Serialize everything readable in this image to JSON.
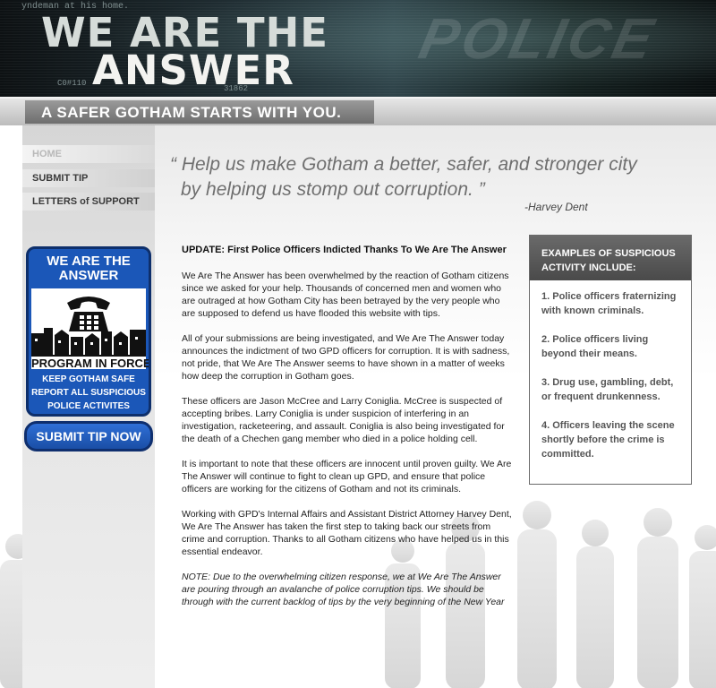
{
  "header": {
    "title_line1": "WE ARE THE",
    "title_line2": "ANSWER",
    "background_print": "yndeman at his home.",
    "code_a": "C0#110",
    "code_b": "31862",
    "tagline": "A SAFER GOTHAM STARTS WITH YOU."
  },
  "nav": {
    "items": [
      {
        "label": "HOME",
        "active": true
      },
      {
        "label": "SUBMIT TIP",
        "active": false
      },
      {
        "label": "LETTERS of SUPPORT",
        "active": false
      }
    ]
  },
  "badge": {
    "title_line1": "WE ARE THE",
    "title_line2": "ANSWER",
    "program": "PROGRAM IN FORCE",
    "line1": "KEEP GOTHAM SAFE",
    "line2": "REPORT ALL SUSPICIOUS",
    "line3": "POLICE ACTIVITES"
  },
  "submit_button": "SUBMIT TIP NOW",
  "quote": {
    "line1": "“ Help us make Gotham a better, safer, and stronger city",
    "line2": "by helping us stomp out corruption. ”",
    "author": "-Harvey Dent"
  },
  "article": {
    "headline": "UPDATE: First Police Officers Indicted Thanks To We Are The Answer",
    "paragraphs": [
      "We Are The Answer has been overwhelmed by the reaction of Gotham citizens since we asked for your help. Thousands of concerned men and women who are outraged at how Gotham City has been betrayed by the very people who are supposed to defend us have flooded this website with tips.",
      "All of your submissions are being investigated, and We Are The Answer today announces the indictment of two GPD officers for corruption. It is with sadness, not pride, that We Are The Answer seems to have shown in a matter of weeks how deep the corruption in Gotham goes.",
      "These officers are Jason McCree and Larry Coniglia. McCree is suspected of accepting bribes. Larry Coniglia is under suspicion of interfering in an investigation, racketeering, and assault. Coniglia is also being investigated for the death of a Chechen gang member who died in a police holding cell.",
      "It is important to note that these officers are innocent until proven guilty. We Are The Answer will continue to fight to clean up GPD, and ensure that police officers are working for the citizens of Gotham and not its criminals.",
      "Working with GPD's Internal Affairs and Assistant District Attorney Harvey Dent, We Are The Answer has taken the first step to taking back our streets from crime and corruption. Thanks to all Gotham citizens who have helped us in this essential endeavor."
    ],
    "note": "NOTE: Due to the overwhelming citizen response, we at We Are The Answer are pouring through an avalanche of police corruption tips. We should be through with the current backlog of tips by the very beginning of the New Year"
  },
  "sidebox": {
    "title": "EXAMPLES OF SUSPICIOUS ACTIVITY INCLUDE:",
    "items": [
      "1. Police officers fraternizing with known criminals.",
      "2. Police officers living beyond their means.",
      "3. Drug use, gambling, debt, or frequent drunkenness.",
      "4. Officers leaving the scene shortly before the crime is committed."
    ]
  },
  "colors": {
    "badge_blue": "#1b57b8",
    "badge_border": "#0e2f6b",
    "tagline_gray": "#7e7e7e",
    "sidebox_header": "#5a5a5a"
  },
  "icons": [
    "telephone-icon",
    "crowd-silhouette",
    "city-skyline"
  ]
}
